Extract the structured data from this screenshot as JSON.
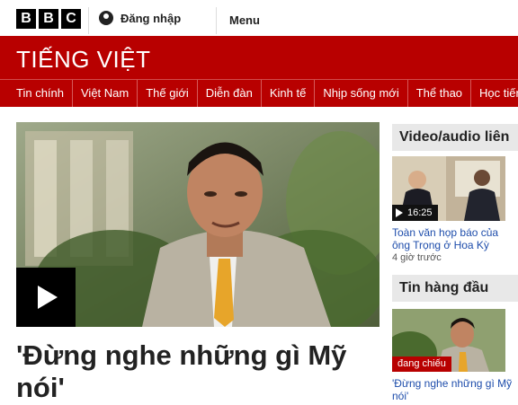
{
  "header": {
    "logo_letters": [
      "B",
      "B",
      "C"
    ],
    "signin_label": "Đăng nhập",
    "menu_label": "Menu"
  },
  "banner": {
    "site_name": "TIẾNG VIỆT"
  },
  "nav": {
    "items": [
      "Tin chính",
      "Việt Nam",
      "Thế giới",
      "Diễn đàn",
      "Kinh tế",
      "Nhịp sống mới",
      "Thể thao",
      "Học tiếng Anh"
    ]
  },
  "main": {
    "headline": "'Đừng nghe những gì Mỹ nói'"
  },
  "sidebar": {
    "video_section_title": "Video/audio liên",
    "video_item": {
      "duration": "16:25",
      "caption": "Toàn văn họp báo của ông Trọng ở Hoa Kỳ",
      "time_ago": "4 giờ trước"
    },
    "top_section_title": "Tin hàng đầu",
    "top_item": {
      "badge": "đang chiếu",
      "caption": "'Đừng nghe những gì Mỹ nói'"
    }
  }
}
